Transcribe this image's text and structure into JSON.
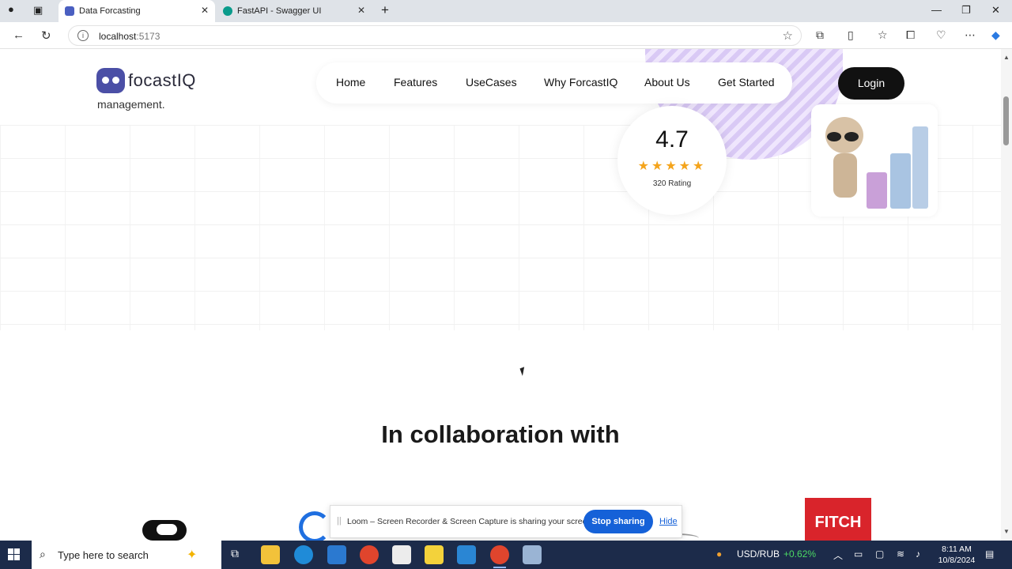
{
  "browser": {
    "tabs": [
      {
        "title": "Data Forcasting",
        "favicon_color": "#4a5fc1",
        "active": true
      },
      {
        "title": "FastAPI - Swagger UI",
        "favicon_color": "#0a9b8b",
        "active": false
      }
    ],
    "new_tab_label": "+",
    "url_host": "localhost",
    "url_port": ":5173",
    "window_controls": {
      "minimize": "—",
      "restore": "❐",
      "close": "✕"
    }
  },
  "site": {
    "logo_text": "focastIQ",
    "hero_fragment": "management.",
    "nav": [
      "Home",
      "Features",
      "UseCases",
      "Why ForcastIQ",
      "About Us",
      "Get Started"
    ],
    "login_label": "Login",
    "rating": {
      "value": "4.7",
      "stars": "★★★★★",
      "count_label": "320 Rating"
    },
    "collab_title": "In collaboration with",
    "partner_fitch": "FITCH",
    "accent_color": "#111111"
  },
  "loom": {
    "message": "Loom – Screen Recorder & Screen Capture is sharing your screen.",
    "stop_label": "Stop sharing",
    "hide_label": "Hide"
  },
  "taskbar": {
    "search_placeholder": "Type here to search",
    "ticker_label": "USD/RUB",
    "ticker_change": "+0.62%",
    "time": "8:11 AM",
    "date": "10/8/2024"
  }
}
